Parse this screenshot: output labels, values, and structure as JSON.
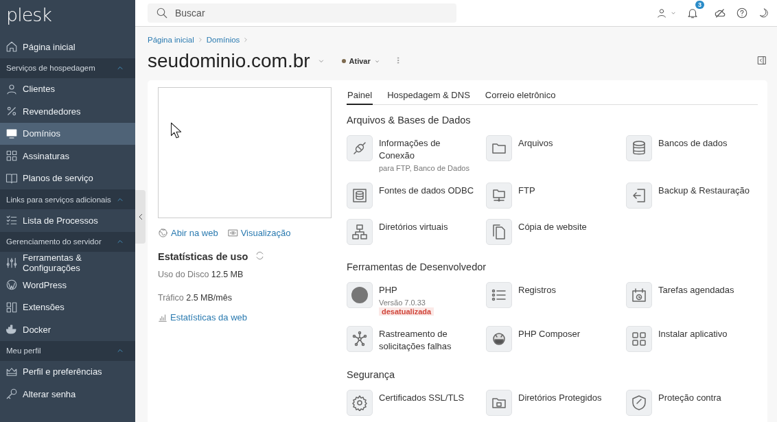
{
  "sidebar": {
    "logo": "plesk",
    "items": [
      {
        "kind": "item",
        "label": "Página inicial",
        "selected": false
      },
      {
        "kind": "section",
        "label": "Serviços de hospedagem",
        "expanded": true
      },
      {
        "kind": "item",
        "label": "Clientes",
        "selected": false
      },
      {
        "kind": "item",
        "label": "Revendedores",
        "selected": false
      },
      {
        "kind": "item",
        "label": "Domínios",
        "selected": true
      },
      {
        "kind": "item",
        "label": "Assinaturas",
        "selected": false
      },
      {
        "kind": "item",
        "label": "Planos de serviço",
        "selected": false
      },
      {
        "kind": "section",
        "label": "Links para serviços adicionais",
        "expanded": true
      },
      {
        "kind": "item",
        "label": "Lista de Processos",
        "selected": false
      },
      {
        "kind": "section",
        "label": "Gerenciamento do servidor",
        "expanded": true
      },
      {
        "kind": "item",
        "label": "Ferramentas & Configurações",
        "selected": false
      },
      {
        "kind": "item",
        "label": "WordPress",
        "selected": false
      },
      {
        "kind": "item",
        "label": "Extensões",
        "selected": false
      },
      {
        "kind": "item",
        "label": "Docker",
        "selected": false
      },
      {
        "kind": "section",
        "label": "Meu perfil",
        "expanded": true
      },
      {
        "kind": "item",
        "label": "Perfil e preferências",
        "selected": false
      },
      {
        "kind": "item",
        "label": "Alterar senha",
        "selected": false
      }
    ]
  },
  "topbar": {
    "search": {
      "placeholder": "Buscar"
    },
    "notifications_badge": "3"
  },
  "breadcrumbs": [
    "Página inicial",
    "Domínios"
  ],
  "domain": {
    "title": "seudominio.com.br",
    "status": "Ativar"
  },
  "preview": {
    "links": [
      "Abir na web",
      "Visualização"
    ]
  },
  "usage": {
    "title": "Estatísticas de uso",
    "rows": [
      {
        "label": "Uso do Disco",
        "value": "12.5 MB"
      },
      {
        "label": "Tráfico",
        "value": "2.5 MB/mês"
      }
    ],
    "link": "Estatísticas da web"
  },
  "tabs": [
    {
      "label": "Painel",
      "selected": true
    },
    {
      "label": "Hospedagem & DNS",
      "selected": false
    },
    {
      "label": "Correio eletrônico",
      "selected": false
    }
  ],
  "sections": [
    {
      "title": "Arquivos & Bases de Dados",
      "tools": [
        {
          "label": "Informações de Conexão",
          "note": "para FTP, Banco de Dados"
        },
        {
          "label": "Arquivos"
        },
        {
          "label": "Bancos de dados"
        },
        {
          "label": "Fontes de dados ODBC"
        },
        {
          "label": "FTP"
        },
        {
          "label": "Backup & Restauração"
        },
        {
          "label": "Diretórios virtuais"
        },
        {
          "label": "Cópia de website"
        }
      ]
    },
    {
      "title": "Ferramentas de Desenvolvedor",
      "tools": [
        {
          "label": "PHP",
          "note": "Versão 7.0.33",
          "badge": "desatualizada"
        },
        {
          "label": "Registros"
        },
        {
          "label": "Tarefas agendadas"
        },
        {
          "label": "Rastreamento de solicitações falhas"
        },
        {
          "label": "PHP Composer"
        },
        {
          "label": "Instalar aplicativo"
        }
      ]
    },
    {
      "title": "Segurança",
      "tools": [
        {
          "label": "Certificados SSL/TLS"
        },
        {
          "label": "Diretórios Protegidos"
        },
        {
          "label": "Proteção contra"
        }
      ]
    }
  ]
}
